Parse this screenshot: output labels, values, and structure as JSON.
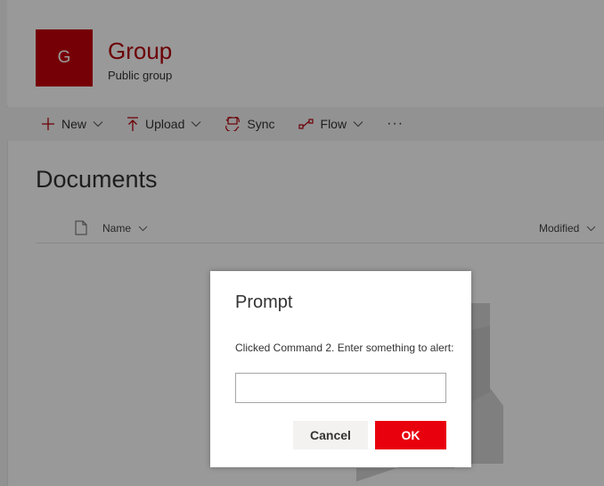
{
  "site": {
    "logo_letter": "G",
    "title": "Group",
    "subtitle": "Public group"
  },
  "command_bar": {
    "new_label": "New",
    "upload_label": "Upload",
    "sync_label": "Sync",
    "flow_label": "Flow",
    "more_label": "···"
  },
  "library": {
    "title": "Documents",
    "columns": [
      "Name",
      "Modified"
    ]
  },
  "dialog": {
    "title": "Prompt",
    "message": "Clicked Command 2. Enter something to alert:",
    "input_value": "",
    "cancel_label": "Cancel",
    "ok_label": "OK"
  },
  "colors": {
    "brand": "#c4000b",
    "ok_button": "#e8000d"
  },
  "icons": [
    "plus-icon",
    "upload-icon",
    "sync-icon",
    "flow-icon",
    "chevron-down-icon",
    "document-icon"
  ]
}
